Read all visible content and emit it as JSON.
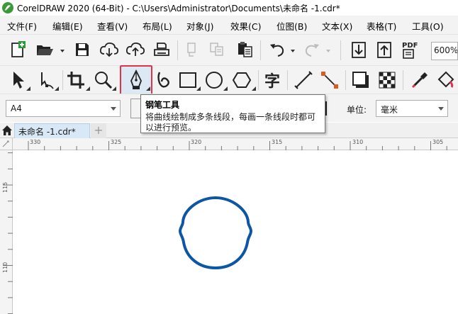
{
  "window": {
    "title": "CorelDRAW 2020 (64-Bit) - C:\\Users\\Administrator\\Documents\\未命名 -1.cdr*"
  },
  "menu": {
    "items": [
      {
        "label": "文件(F)"
      },
      {
        "label": "编辑(E)"
      },
      {
        "label": "查看(V)"
      },
      {
        "label": "布局(L)"
      },
      {
        "label": "对象(J)"
      },
      {
        "label": "效果(C)"
      },
      {
        "label": "位图(B)"
      },
      {
        "label": "文本(X)"
      },
      {
        "label": "表格(T)"
      },
      {
        "label": "工具(O)"
      }
    ]
  },
  "standard_toolbar": {
    "zoom_value": "600%",
    "pdf_label": "PDF"
  },
  "toolbox": {
    "text_tool_glyph": "字",
    "active_tool": "pen-tool"
  },
  "property_bar": {
    "page_size": "A4",
    "units_label": "单位:",
    "units_value": "毫米"
  },
  "tooltip": {
    "title": "钢笔工具",
    "body": "将曲线绘制成多条线段，每画一条线段时都可以进行预览。"
  },
  "document_tabs": {
    "active_tab": "未命名 -1.cdr*",
    "add_tab": "+"
  },
  "rulers": {
    "horizontal_ticks": [
      "330",
      "325",
      "320",
      "315",
      "310",
      "305"
    ],
    "vertical_ticks": [
      "115",
      "110"
    ]
  },
  "colors": {
    "accent_highlight": "#e0334a",
    "shape_stroke": "#0d56a6",
    "toolbar_bg": "#f3f3f3"
  }
}
